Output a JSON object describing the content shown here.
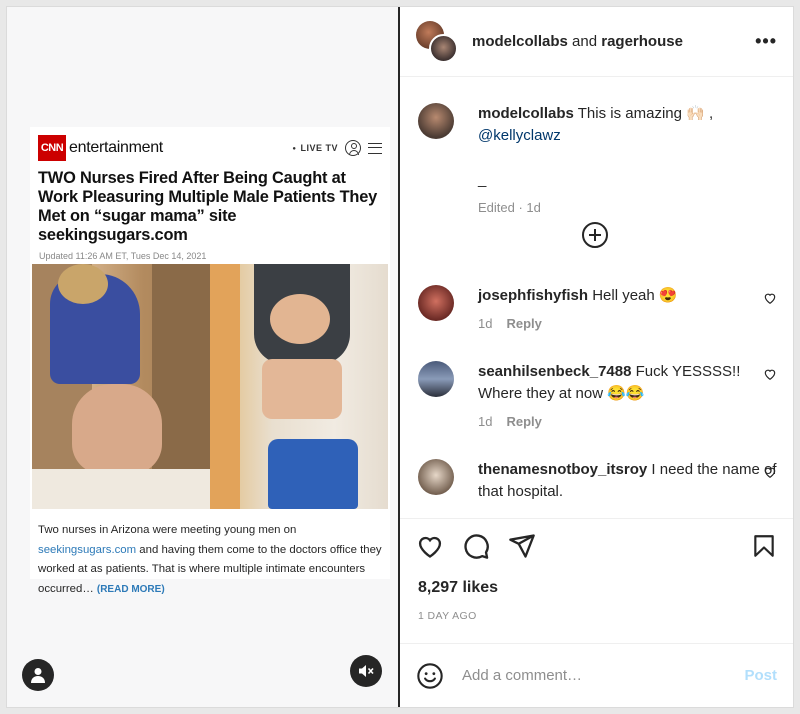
{
  "post": {
    "media": {
      "cnn_logo": "CNN",
      "brand": "entertainment",
      "live_label": "LIVE TV",
      "headline": "TWO Nurses Fired After Being Caught at Work Pleasuring Multiple Male Patients They Met on “sugar mama” site seekingsugars.com",
      "dateline": "Updated 11:26 AM ET, Tues Dec 14, 2021",
      "body_1": "Two nurses in Arizona were meeting young men on",
      "body_link": "seekingsugars.com",
      "body_2": " and having them come to the doctors office they worked at as patients. That is where multiple intimate encounters occurred… ",
      "read_more": "(READ MORE)",
      "brand_color": "#cc0000",
      "link_color": "#2d7ab8"
    },
    "header": {
      "user1": "modelcollabs",
      "joiner": "and",
      "user2": "ragerhouse",
      "more_icon": "more-horizontal-icon"
    },
    "caption": {
      "username": "modelcollabs",
      "text": "This is amazing 🙌🏻 ,",
      "mention": "@kellyclawz",
      "extra": "_",
      "edited": "Edited · 1d"
    },
    "load_more_icon": "plus-circle-icon",
    "comments": [
      {
        "username": "josephfishyfish",
        "text": "Hell yeah 😍",
        "age": "1d",
        "reply": "Reply"
      },
      {
        "username": "seanhilsenbeck_7488",
        "text": "Fuck YESSSS!! Where they at now 😂😂",
        "age": "1d",
        "reply": "Reply"
      },
      {
        "username": "thenamesnotboy_itsroy",
        "text": "I need the name of that hospital.",
        "age": "",
        "reply": ""
      }
    ],
    "likes": "8,297 likes",
    "time_ago": "1 DAY AGO",
    "add_comment": {
      "placeholder": "Add a comment…",
      "post_label": "Post",
      "post_color": "#b2dffc"
    },
    "accent": "#0095f6"
  }
}
